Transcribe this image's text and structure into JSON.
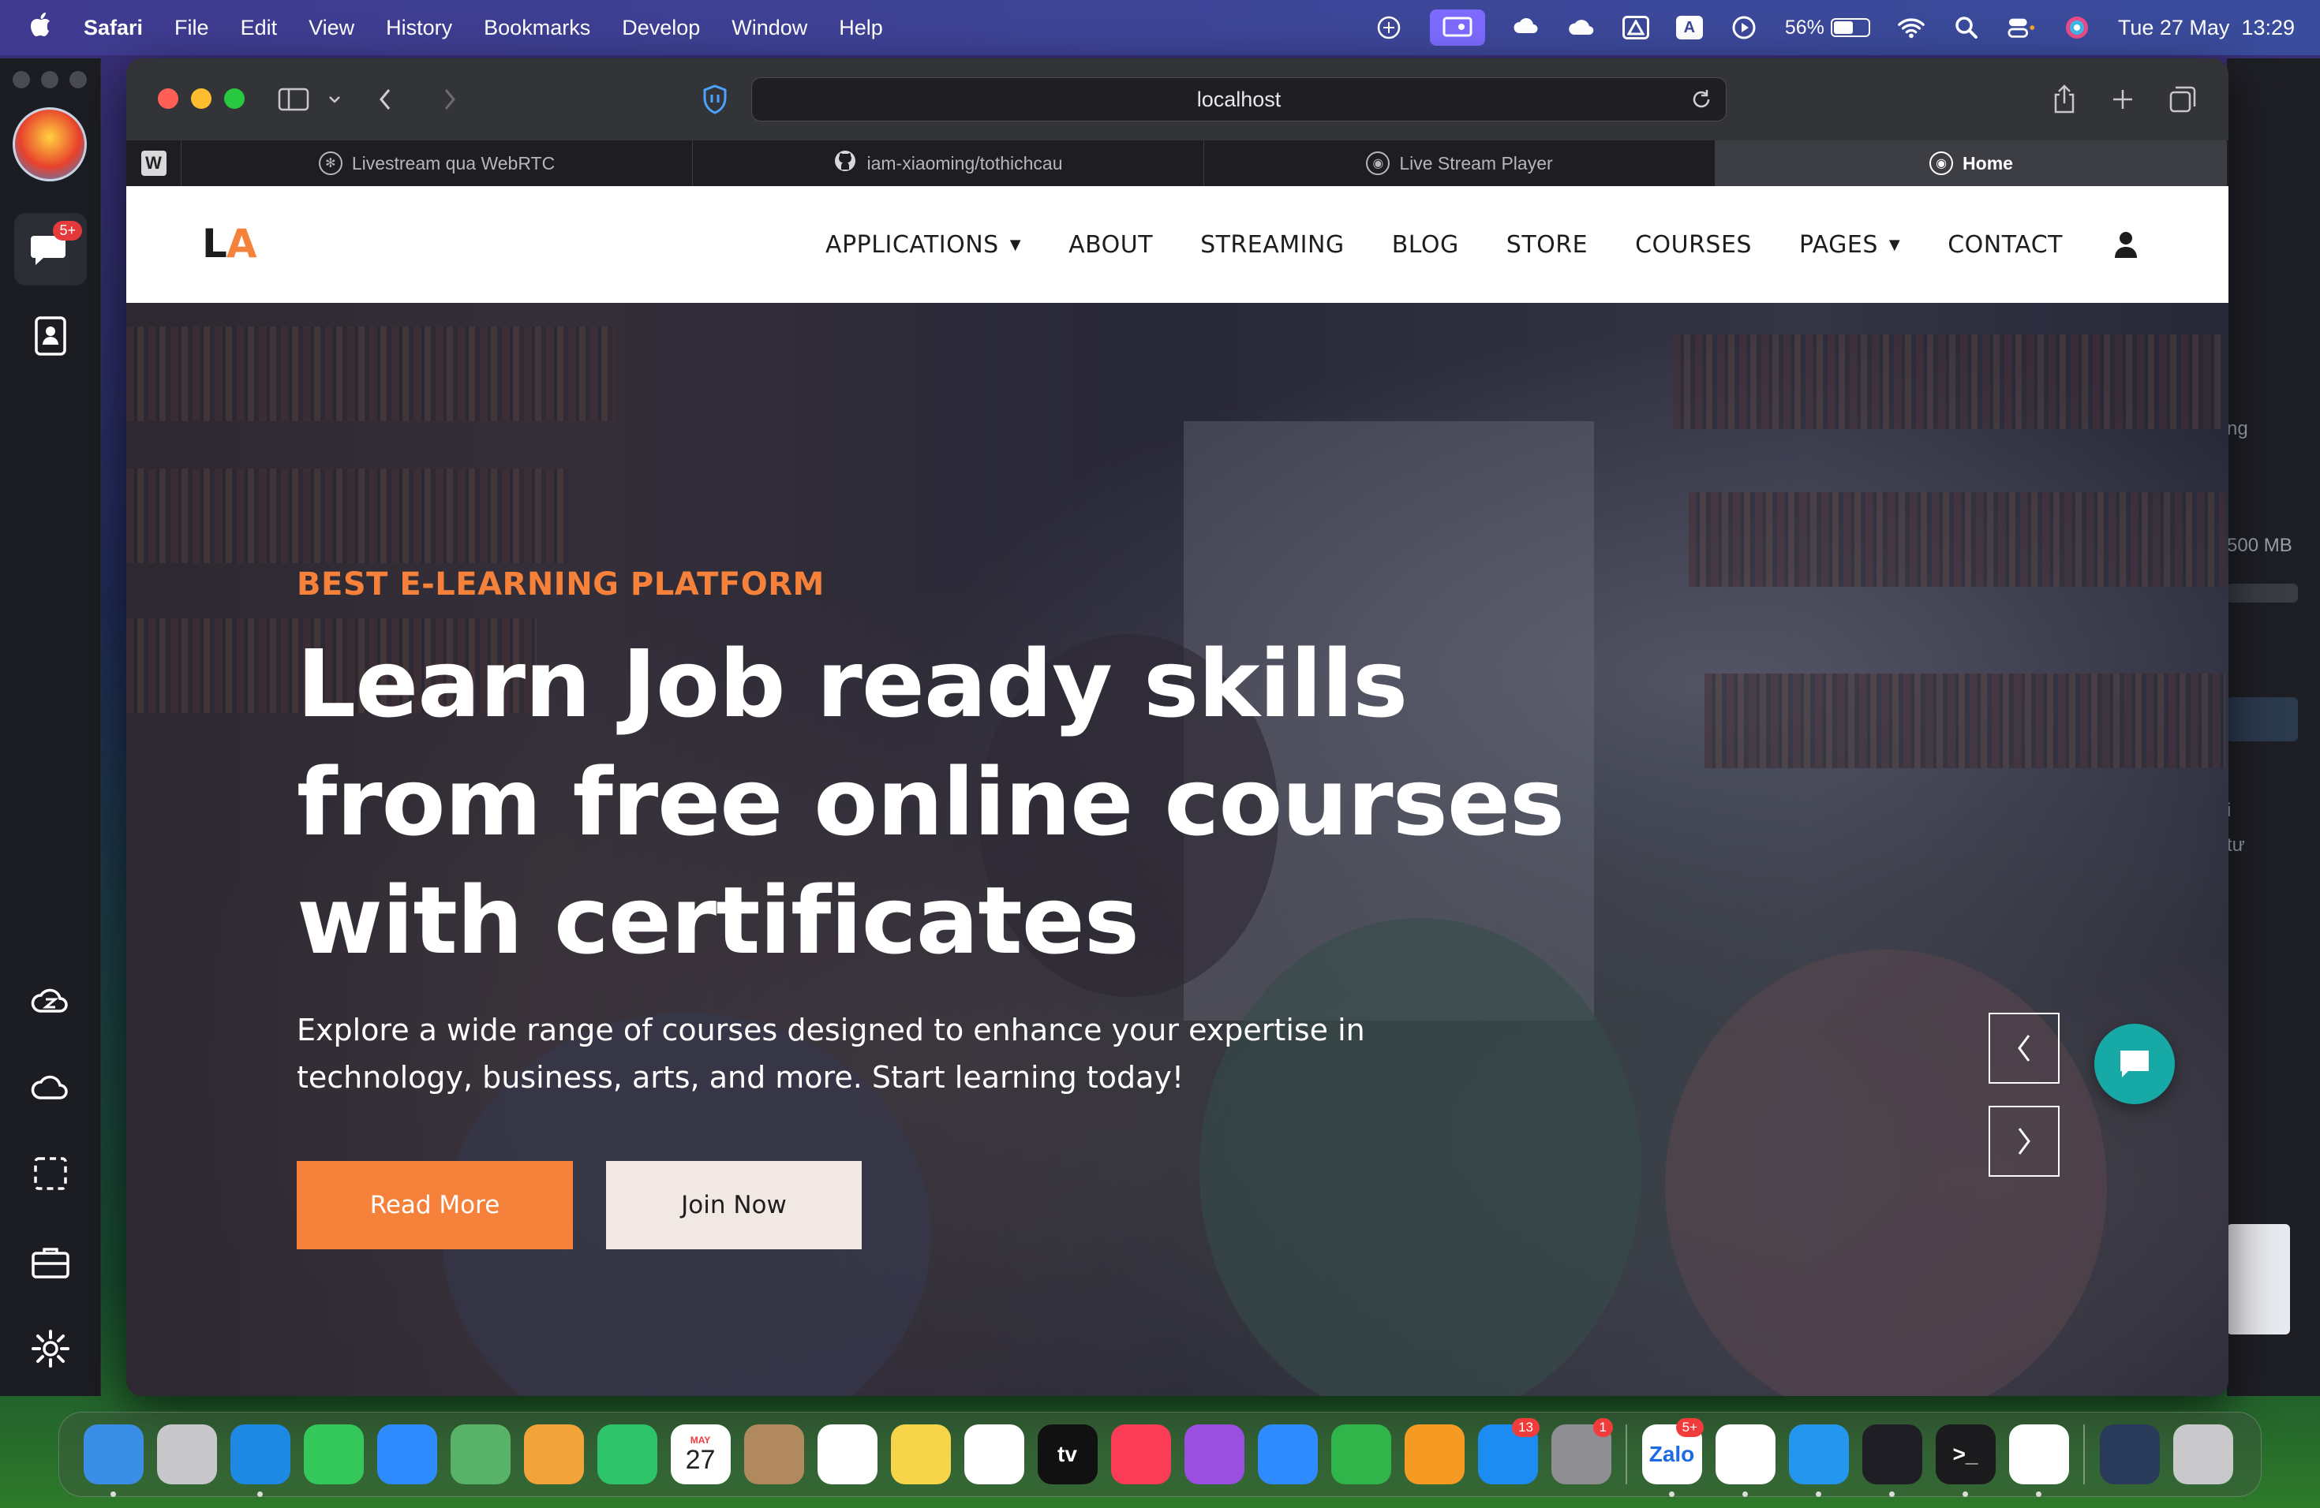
{
  "menubar": {
    "app_name": "Safari",
    "menus": [
      "File",
      "Edit",
      "View",
      "History",
      "Bookmarks",
      "Develop",
      "Window",
      "Help"
    ],
    "battery_percent": "56%",
    "battery_level": 0.56,
    "clock": "Tue 27 May  13:29",
    "status_icons": [
      "openai-icon",
      "screen-share-icon",
      "weather-icon",
      "icloud-icon",
      "drive-icon",
      "input-source-icon",
      "play-icon",
      "battery-icon",
      "wifi-icon",
      "search-icon",
      "control-center-icon",
      "siri-icon"
    ],
    "input_source_letter": "A"
  },
  "left_app": {
    "badge": "5+",
    "icons": [
      "chat-icon",
      "contacts-icon",
      "cloud-z-icon",
      "cloud-icon",
      "screenshot-icon",
      "briefcase-icon",
      "settings-icon"
    ]
  },
  "right_peek": {
    "text1": "ng",
    "text2": "500 MB",
    "text3": "i",
    "text4": "tư"
  },
  "browser": {
    "url": "localhost",
    "tabs": [
      {
        "label": "",
        "pinned": true,
        "icon_letter": "W"
      },
      {
        "label": "Livestream qua WebRTC",
        "icon": "openai-icon"
      },
      {
        "label": "iam-xiaoming/tothichcau",
        "icon": "github-icon"
      },
      {
        "label": "Live Stream Player",
        "icon": "stream-icon"
      },
      {
        "label": "Home",
        "icon": "stream-icon",
        "active": true
      }
    ]
  },
  "site": {
    "logo_l": "L",
    "logo_a": "A",
    "nav": [
      {
        "label": "APPLICATIONS",
        "dropdown": true
      },
      {
        "label": "ABOUT"
      },
      {
        "label": "STREAMING"
      },
      {
        "label": "BLOG"
      },
      {
        "label": "STORE"
      },
      {
        "label": "COURSES"
      },
      {
        "label": "PAGES",
        "dropdown": true
      },
      {
        "label": "CONTACT"
      }
    ],
    "hero": {
      "eyebrow": "BEST E-LEARNING PLATFORM",
      "headline_line1": "Learn Job ready skills",
      "headline_line2": "from free online courses",
      "headline_line3": "with certificates",
      "subtext": "Explore a wide range of courses designed to enhance your expertise in technology, business, arts, and more. Start learning today!",
      "primary_cta": "Read More",
      "secondary_cta": "Join Now"
    },
    "colors": {
      "accent": "#f5813a",
      "chat_fab": "#17a9a5",
      "secondary_btn": "#f1e8e4"
    }
  },
  "dock": {
    "apps": [
      {
        "name": "finder-icon",
        "color": "#3a8ee6",
        "label": ""
      },
      {
        "name": "launchpad-icon",
        "color": "#c7c7cc",
        "label": ""
      },
      {
        "name": "safari-icon",
        "color": "#1e88e5",
        "label": ""
      },
      {
        "name": "messages-icon",
        "color": "#34c759",
        "label": ""
      },
      {
        "name": "mail-icon",
        "color": "#2f8cff",
        "label": ""
      },
      {
        "name": "maps-icon",
        "color": "#58b368",
        "label": ""
      },
      {
        "name": "photos-icon",
        "color": "#f2a33a",
        "label": ""
      },
      {
        "name": "facetime-icon",
        "color": "#2ec46a",
        "label": ""
      },
      {
        "name": "calendar-icon",
        "color": "#ffffff",
        "label": "27"
      },
      {
        "name": "contacts-icon",
        "color": "#b08a5e",
        "label": ""
      },
      {
        "name": "reminders-icon",
        "color": "#ffffff",
        "label": ""
      },
      {
        "name": "notes-icon",
        "color": "#f7d54a",
        "label": ""
      },
      {
        "name": "freeform-icon",
        "color": "#ffffff",
        "label": ""
      },
      {
        "name": "appletv-icon",
        "color": "#111111",
        "label": "tv"
      },
      {
        "name": "music-icon",
        "color": "#fa3c57",
        "label": ""
      },
      {
        "name": "podcasts-icon",
        "color": "#9b4fe0",
        "label": ""
      },
      {
        "name": "keynote-icon",
        "color": "#2f8cff",
        "label": ""
      },
      {
        "name": "numbers-icon",
        "color": "#30b54b",
        "label": ""
      },
      {
        "name": "pages-icon",
        "color": "#f59b24",
        "label": ""
      },
      {
        "name": "appstore-icon",
        "color": "#1d8cf2",
        "label": "",
        "badge": "13"
      },
      {
        "name": "system-settings-icon",
        "color": "#8e8e93",
        "label": "",
        "badge": "1"
      },
      {
        "separator": true
      },
      {
        "name": "zalo-icon",
        "color": "#ffffff",
        "label": "Zalo",
        "badge": "5+"
      },
      {
        "name": "vscode-icon",
        "color": "#ffffff",
        "label": ""
      },
      {
        "name": "docker-icon",
        "color": "#2496ed",
        "label": ""
      },
      {
        "name": "chatgpt-icon",
        "color": "#1e1e24",
        "label": ""
      },
      {
        "name": "terminal-icon",
        "color": "#1b1b1e",
        "label": ">_"
      },
      {
        "name": "chrome-icon",
        "color": "#ffffff",
        "label": ""
      },
      {
        "separator": true
      },
      {
        "name": "downloads-stack-icon",
        "color": "#2a3a5a",
        "label": ""
      },
      {
        "name": "trash-icon",
        "color": "#c9c9cc",
        "label": ""
      }
    ],
    "calendar_month": "MAY"
  }
}
